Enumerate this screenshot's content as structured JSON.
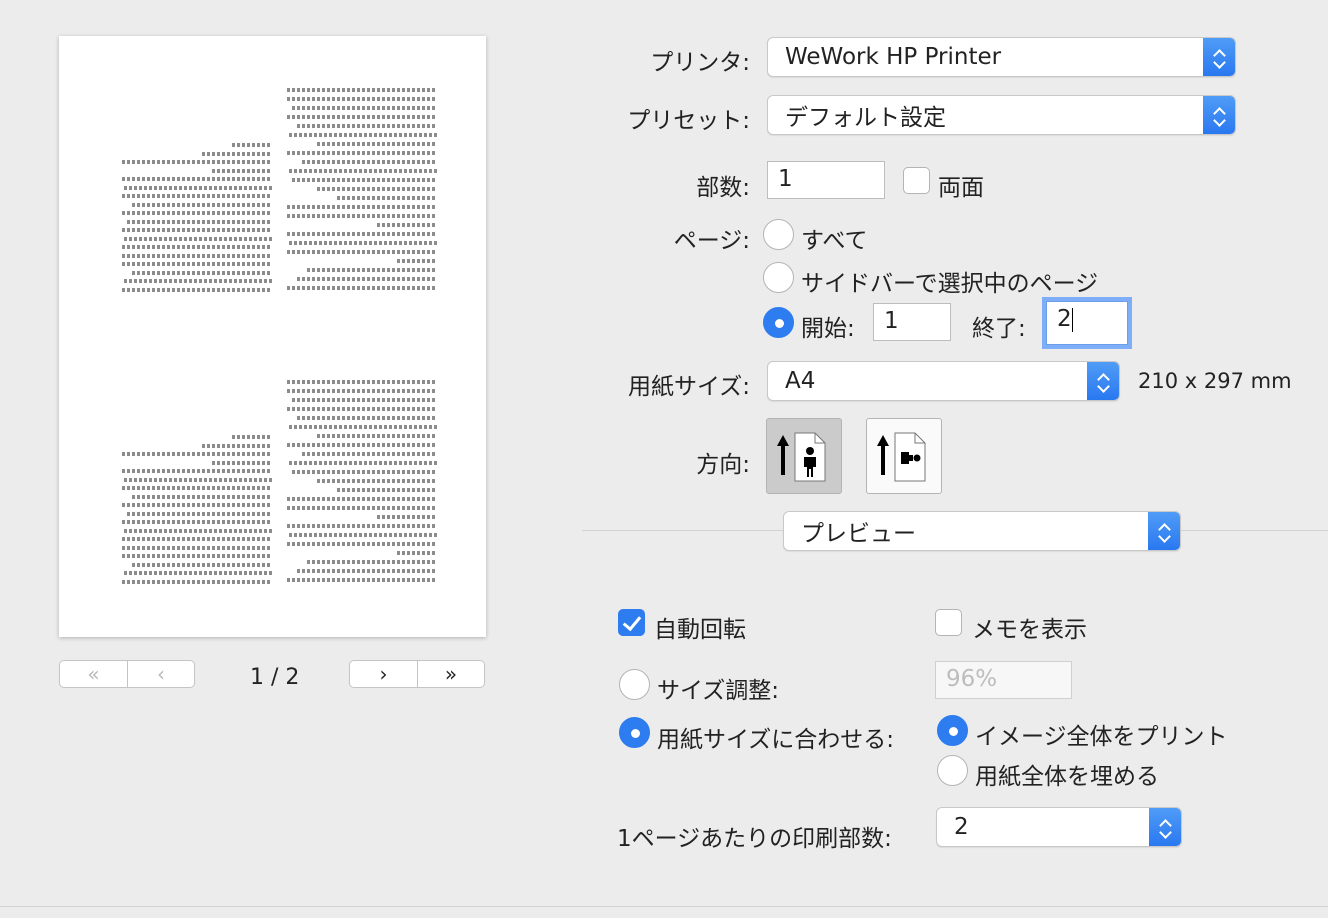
{
  "preview": {
    "page_count_label": "1 / 2"
  },
  "pager": {
    "first_icon": "double-chevron-left-icon",
    "prev_icon": "chevron-left-icon",
    "next_icon": "chevron-right-icon",
    "last_icon": "double-chevron-right-icon"
  },
  "printer": {
    "label": "プリンタ:",
    "value": "WeWork HP Printer"
  },
  "preset": {
    "label": "プリセット:",
    "value": "デフォルト設定"
  },
  "copies": {
    "label": "部数:",
    "value": "1",
    "duplex_label": "両面",
    "duplex_checked": false
  },
  "pages": {
    "label": "ページ:",
    "all_label": "すべて",
    "sidebar_label": "サイドバーで選択中のページ",
    "from_label": "開始:",
    "from_value": "1",
    "to_label": "終了:",
    "to_value": "2",
    "selected": "range"
  },
  "paper": {
    "label": "用紙サイズ:",
    "value": "A4",
    "dimensions": "210 x 297 mm"
  },
  "orientation": {
    "label": "方向:",
    "selected": "portrait"
  },
  "section": {
    "value": "プレビュー"
  },
  "options": {
    "auto_rotate_label": "自動回転",
    "auto_rotate_checked": true,
    "show_notes_label": "メモを表示",
    "show_notes_checked": false,
    "scale_label": "サイズ調整:",
    "scale_value": "96%",
    "fit_label": "用紙サイズに合わせる:",
    "print_entire_label": "イメージ全体をプリント",
    "fill_paper_label": "用紙全体を埋める",
    "per_sheet_label": "1ページあたりの印刷部数:",
    "per_sheet_value": "2"
  },
  "colors": {
    "accent": "#2d7cf0",
    "background": "#ececec"
  }
}
